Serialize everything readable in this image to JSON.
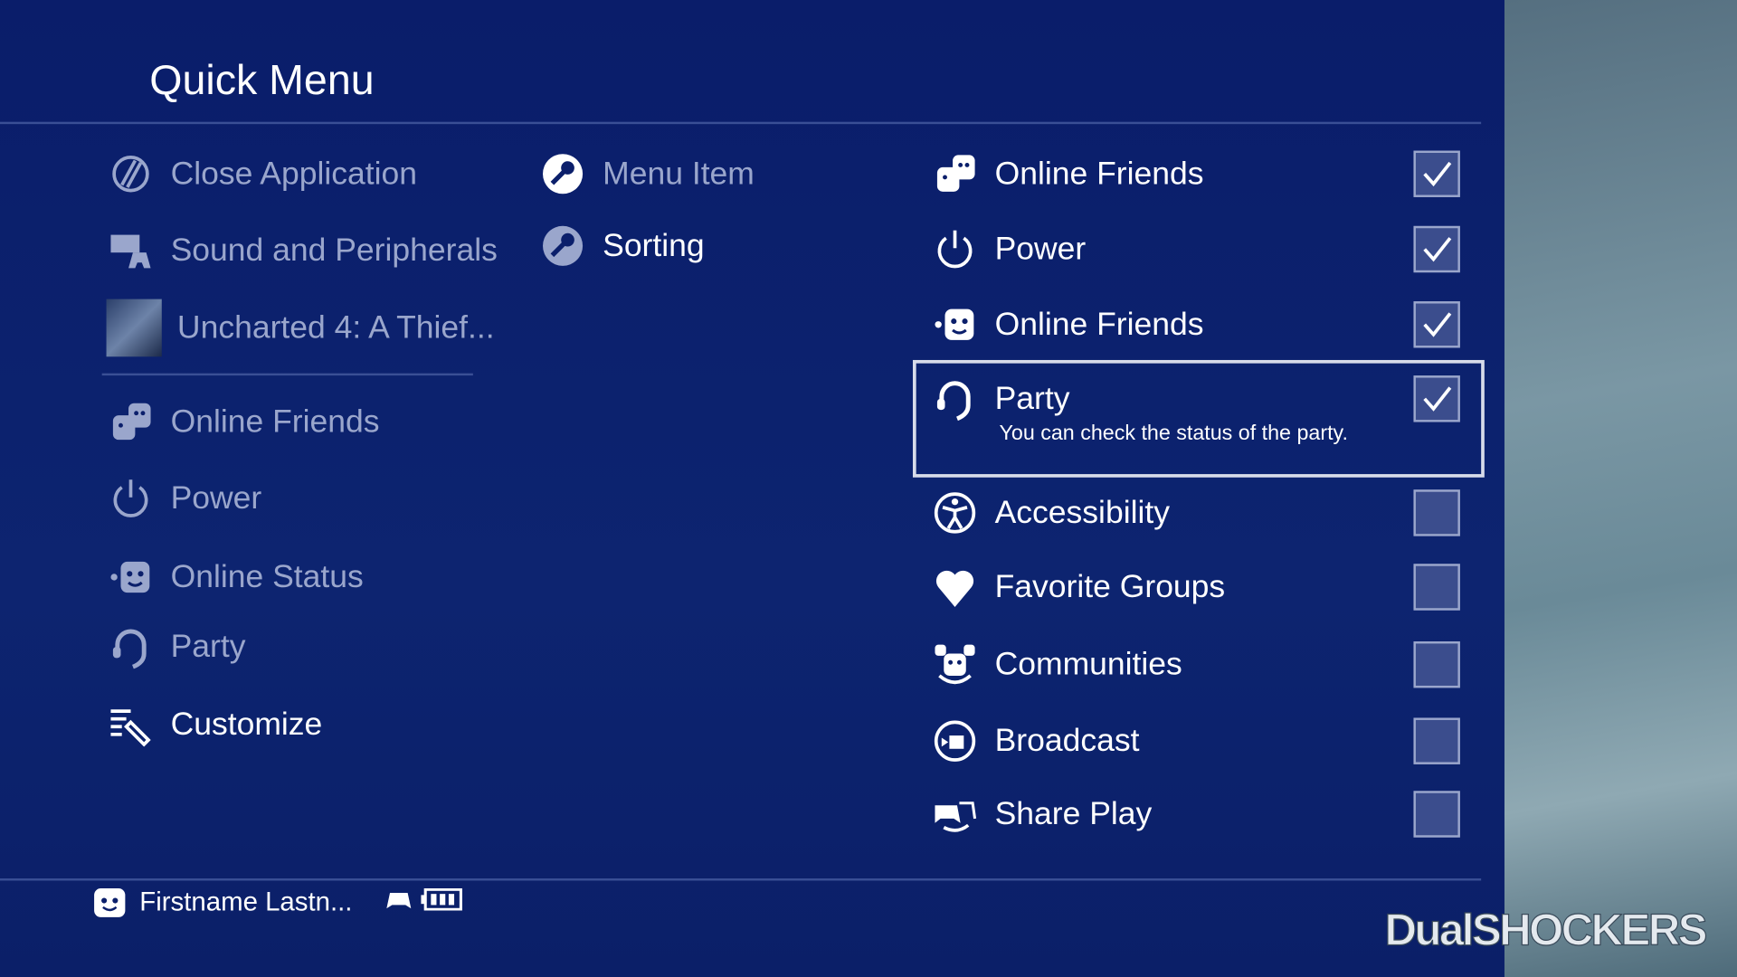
{
  "title": "Quick Menu",
  "left_menu": [
    {
      "label": "Close Application",
      "icon": "close-app-icon",
      "dim": true
    },
    {
      "label": "Sound and Peripherals",
      "icon": "peripherals-icon",
      "dim": true
    },
    {
      "label": "Uncharted 4: A Thief...",
      "icon": "game-thumbnail",
      "dim": true
    },
    {
      "label": "Online Friends",
      "icon": "friends-icon",
      "dim": true
    },
    {
      "label": "Power",
      "icon": "power-icon",
      "dim": true
    },
    {
      "label": "Online Status",
      "icon": "online-status-icon",
      "dim": true
    },
    {
      "label": "Party",
      "icon": "headset-icon",
      "dim": true
    },
    {
      "label": "Customize",
      "icon": "customize-icon",
      "dim": false
    }
  ],
  "middle_menu": [
    {
      "label": "Menu Item",
      "icon": "wrench-icon"
    },
    {
      "label": "Sorting",
      "icon": "wrench-icon"
    }
  ],
  "options": [
    {
      "label": "Online Friends",
      "icon": "friends-icon",
      "checked": true
    },
    {
      "label": "Power",
      "icon": "power-icon",
      "checked": true
    },
    {
      "label": "Online Friends",
      "icon": "online-status-icon",
      "checked": true
    },
    {
      "label": "Party",
      "icon": "headset-icon",
      "checked": true,
      "selected": true,
      "description": "You can check the status of the party."
    },
    {
      "label": "Accessibility",
      "icon": "accessibility-icon",
      "checked": false
    },
    {
      "label": "Favorite Groups",
      "icon": "heart-icon",
      "checked": false
    },
    {
      "label": "Communities",
      "icon": "communities-icon",
      "checked": false
    },
    {
      "label": "Broadcast",
      "icon": "broadcast-icon",
      "checked": false
    },
    {
      "label": "Share Play",
      "icon": "share-play-icon",
      "checked": false
    }
  ],
  "footer": {
    "user": "Firstname Lastn...",
    "battery_level": "3/3"
  },
  "watermark": "DualSHOCKERS"
}
